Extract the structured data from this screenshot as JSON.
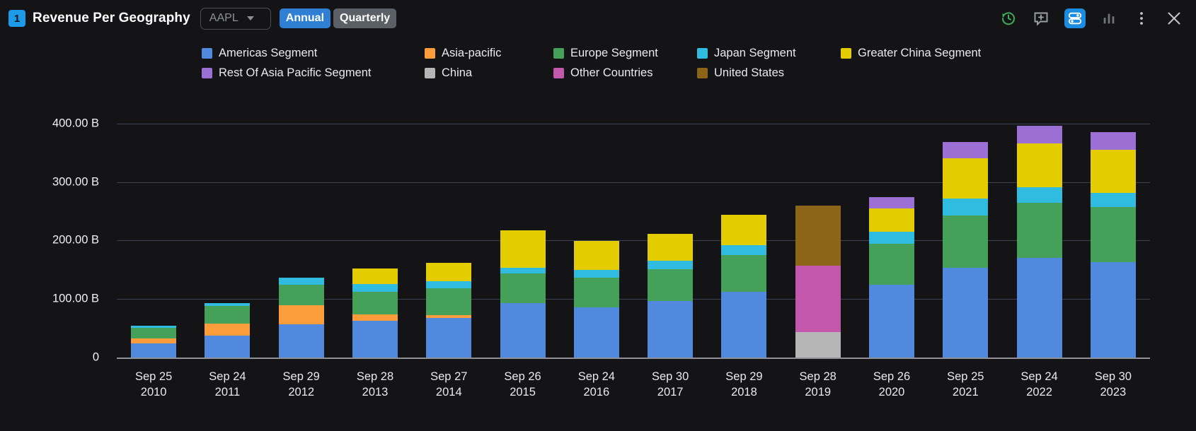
{
  "header": {
    "panel_number": "1",
    "title": "Revenue Per Geography",
    "ticker": "AAPL",
    "ticker_caret_icon": "chevron-down-icon",
    "period_buttons": [
      {
        "label": "Annual",
        "active": true
      },
      {
        "label": "Quarterly",
        "active": false
      }
    ],
    "icons": [
      {
        "name": "history-clock-icon",
        "color": "#3faa5a",
        "active": false
      },
      {
        "name": "comment-add-icon",
        "color": "#9aa0a6",
        "active": false
      },
      {
        "name": "settings-sliders-icon",
        "color": "#ffffff",
        "active": true
      },
      {
        "name": "bar-chart-icon",
        "color": "#6f757c",
        "active": false
      },
      {
        "name": "more-vertical-icon",
        "color": "#c3c7cc",
        "active": false
      },
      {
        "name": "close-icon",
        "color": "#c3c7cc",
        "active": false
      }
    ]
  },
  "colors": {
    "americas": "#5089dd",
    "asia_pacific": "#fb9d3b",
    "europe": "#45a05a",
    "japan": "#30bbe0",
    "greater_china": "#e3cc00",
    "rest_of_asia_pacific": "#9b6fd4",
    "china": "#b6b6b6",
    "other_countries": "#c257ab",
    "united_states": "#8c6519",
    "background": "#141416",
    "grid": "#3b4350",
    "axis": "#8d9197",
    "accent": "#1b8ce0"
  },
  "chart_data": {
    "type": "bar",
    "stacked": true,
    "title": "Revenue Per Geography",
    "xlabel": "",
    "ylabel": "",
    "ylim": [
      0,
      435
    ],
    "unit": "B",
    "grid": true,
    "legend_position": "top",
    "ytick_labels": [
      "400.00 B",
      "300.00 B",
      "200.00 B",
      "100.00 B",
      "0"
    ],
    "ytick_values": [
      400,
      300,
      200,
      100,
      0
    ],
    "categories": [
      "Sep 25 2010",
      "Sep 24 2011",
      "Sep 29 2012",
      "Sep 28 2013",
      "Sep 27 2014",
      "Sep 26 2015",
      "Sep 24 2016",
      "Sep 30 2017",
      "Sep 29 2018",
      "Sep 28 2019",
      "Sep 26 2020",
      "Sep 25 2021",
      "Sep 24 2022",
      "Sep 30 2023"
    ],
    "category_lines": [
      [
        "Sep 25",
        "2010"
      ],
      [
        "Sep 24",
        "2011"
      ],
      [
        "Sep 29",
        "2012"
      ],
      [
        "Sep 28",
        "2013"
      ],
      [
        "Sep 27",
        "2014"
      ],
      [
        "Sep 26",
        "2015"
      ],
      [
        "Sep 24",
        "2016"
      ],
      [
        "Sep 30",
        "2017"
      ],
      [
        "Sep 29",
        "2018"
      ],
      [
        "Sep 28",
        "2019"
      ],
      [
        "Sep 26",
        "2020"
      ],
      [
        "Sep 25",
        "2021"
      ],
      [
        "Sep 24",
        "2022"
      ],
      [
        "Sep 30",
        "2023"
      ]
    ],
    "series": [
      {
        "name": "Americas Segment",
        "color_key": "americas",
        "values": [
          24,
          38,
          57,
          63,
          68,
          93,
          86,
          97,
          112,
          0,
          125,
          153,
          170,
          163
        ]
      },
      {
        "name": "Asia-pacific",
        "color_key": "asia_pacific",
        "values": [
          9,
          20,
          32,
          11,
          5,
          0,
          0,
          0,
          0,
          0,
          0,
          0,
          0,
          0
        ]
      },
      {
        "name": "Europe Segment",
        "color_key": "europe",
        "values": [
          18,
          30,
          36,
          38,
          45,
          51,
          50,
          54,
          63,
          0,
          69,
          90,
          95,
          94
        ]
      },
      {
        "name": "Japan Segment",
        "color_key": "japan",
        "values": [
          3,
          5,
          11,
          14,
          12,
          10,
          14,
          15,
          17,
          0,
          21,
          29,
          26,
          25
        ]
      },
      {
        "name": "Greater China Segment",
        "color_key": "greater_china",
        "values": [
          0,
          0,
          0,
          26,
          32,
          63,
          50,
          45,
          52,
          0,
          40,
          69,
          75,
          73
        ]
      },
      {
        "name": "Rest Of Asia Pacific Segment",
        "color_key": "rest_of_asia_pacific",
        "values": [
          0,
          0,
          0,
          0,
          0,
          0,
          0,
          0,
          0,
          0,
          19,
          27,
          30,
          30
        ]
      },
      {
        "name": "China",
        "color_key": "china",
        "values": [
          0,
          0,
          0,
          0,
          0,
          0,
          0,
          0,
          0,
          44,
          0,
          0,
          0,
          0
        ]
      },
      {
        "name": "Other Countries",
        "color_key": "other_countries",
        "values": [
          0,
          0,
          0,
          0,
          0,
          0,
          0,
          0,
          0,
          113,
          0,
          0,
          0,
          0
        ]
      },
      {
        "name": "United States",
        "color_key": "united_states",
        "values": [
          0,
          0,
          0,
          0,
          0,
          0,
          0,
          0,
          0,
          103,
          0,
          0,
          0,
          0
        ]
      }
    ],
    "totals": [
      54,
      93,
      136,
      152,
      162,
      217,
      200,
      211,
      244,
      260,
      274,
      368,
      396,
      385
    ],
    "legend": [
      {
        "label": "Americas Segment",
        "color_key": "americas"
      },
      {
        "label": "Asia-pacific",
        "color_key": "asia_pacific"
      },
      {
        "label": "Europe Segment",
        "color_key": "europe"
      },
      {
        "label": "Japan Segment",
        "color_key": "japan"
      },
      {
        "label": "Greater China Segment",
        "color_key": "greater_china"
      },
      {
        "label": "Rest Of Asia Pacific Segment",
        "color_key": "rest_of_asia_pacific"
      },
      {
        "label": "China",
        "color_key": "china"
      },
      {
        "label": "Other Countries",
        "color_key": "other_countries"
      },
      {
        "label": "United States",
        "color_key": "united_states"
      }
    ]
  }
}
